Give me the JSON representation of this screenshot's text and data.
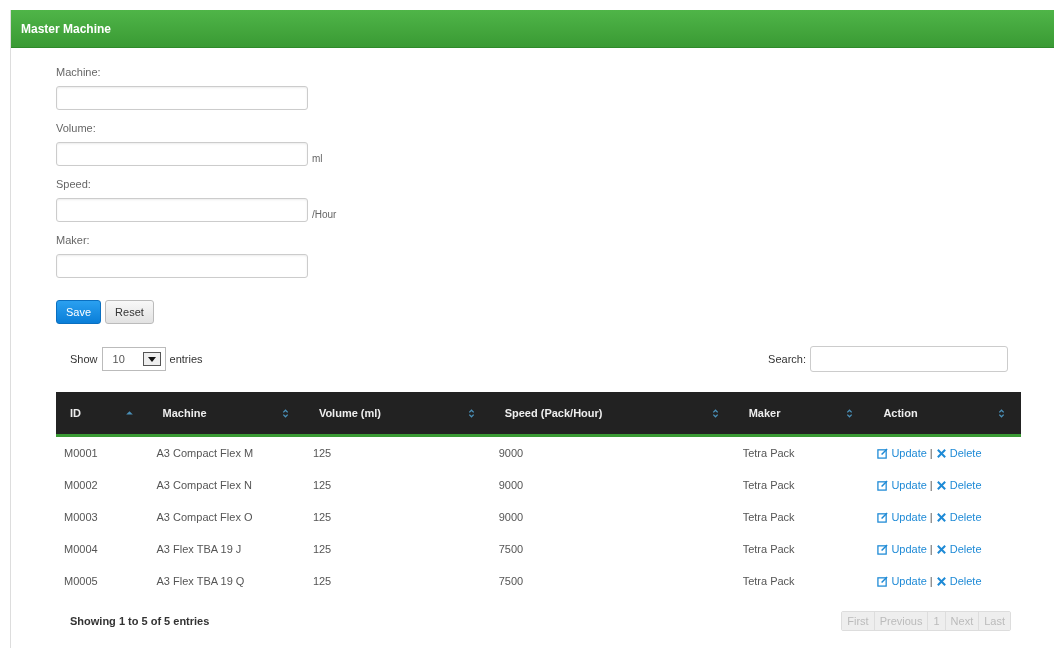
{
  "panel": {
    "title": "Master Machine"
  },
  "form": {
    "fields": [
      {
        "label": "Machine:"
      },
      {
        "label": "Volume:",
        "unit": "ml"
      },
      {
        "label": "Speed:",
        "unit": "/Hour"
      },
      {
        "label": "Maker:"
      }
    ],
    "buttons": [
      {
        "label": "Save",
        "kind": "primary"
      },
      {
        "label": "Reset",
        "kind": "default"
      }
    ]
  },
  "length_control": {
    "before": "Show",
    "value": "10",
    "after": "entries"
  },
  "search": {
    "label": "Search:"
  },
  "table": {
    "columns": [
      {
        "label": "ID",
        "sorted": true
      },
      {
        "label": "Machine",
        "sorted": false
      },
      {
        "label": "Volume (ml)",
        "sorted": false
      },
      {
        "label": "Speed (Pack/Hour)",
        "sorted": false
      },
      {
        "label": "Maker",
        "sorted": false
      },
      {
        "label": "Action",
        "sorted": false
      }
    ],
    "rows": [
      {
        "cells": [
          "M0001",
          "A3 Compact Flex M",
          "125",
          "9000",
          "Tetra Pack"
        ],
        "update": "Update",
        "separator": "|",
        "delete": "Delete"
      },
      {
        "cells": [
          "M0002",
          "A3 Compact Flex N",
          "125",
          "9000",
          "Tetra Pack"
        ],
        "update": "Update",
        "separator": "|",
        "delete": "Delete"
      },
      {
        "cells": [
          "M0003",
          "A3 Compact Flex O",
          "125",
          "9000",
          "Tetra Pack"
        ],
        "update": "Update",
        "separator": "|",
        "delete": "Delete"
      },
      {
        "cells": [
          "M0004",
          "A3 Flex TBA 19 J",
          "125",
          "7500",
          "Tetra Pack"
        ],
        "update": "Update",
        "separator": "|",
        "delete": "Delete"
      },
      {
        "cells": [
          "M0005",
          "A3 Flex TBA 19 Q",
          "125",
          "7500",
          "Tetra Pack"
        ],
        "update": "Update",
        "separator": "|",
        "delete": "Delete"
      }
    ]
  },
  "info": "Showing 1 to 5 of 5 entries",
  "pagination": [
    {
      "label": "First",
      "disabled": true
    },
    {
      "label": "Previous",
      "disabled": true
    },
    {
      "label": "1",
      "disabled": true
    },
    {
      "label": "Next",
      "disabled": true
    },
    {
      "label": "Last",
      "disabled": true
    }
  ]
}
